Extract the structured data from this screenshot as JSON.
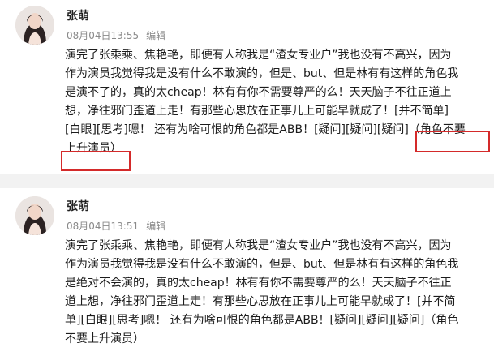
{
  "posts": [
    {
      "author": "张萌",
      "time": "08月04日13:55",
      "edit_label": "编辑",
      "lines": [
        "演完了张乘乘、焦艳艳，即便有人称我是“渣女专业户”我也没有不高兴，因为",
        "作为演员我觉得我是没有什么不敢演的，但是、but、但是林有有这样的角色我",
        "是演不了的，真的太cheap！林有有你不需要尊严的么！天天脑子不往正道上",
        "想，净往邪门歪道上走！有那些心思放在正事儿上可能早就成了！[并不简单]",
        "[白眼][思考]嗯！ 还有为啥可恨的角色都是ABB！[疑问][疑问][疑问]（角色不要",
        "上升演员）"
      ]
    },
    {
      "author": "张萌",
      "time": "08月04日13:51",
      "edit_label": "编辑",
      "lines": [
        "演完了张乘乘、焦艳艳，即便有人称我是“渣女专业户”我也没有不高兴，因为",
        "作为演员我觉得我是没有什么不敢演的，但是、but、但是林有有这样的角色我",
        "是绝对不会演的，真的太cheap！林有有你不需要尊严的么！天天脑子不往正",
        "道上想，净往邪门歪道上走！有那些心思放在正事儿上可能早就成了！[并不简",
        "单][白眼][思考]嗯！ 还有为啥可恨的角色都是ABB！[疑问][疑问][疑问]（角色",
        "不要上升演员）"
      ]
    }
  ],
  "colors": {
    "highlight_box": "#d42a2a",
    "divider": "#f2f2f2",
    "meta_text": "#8a8a8a"
  }
}
